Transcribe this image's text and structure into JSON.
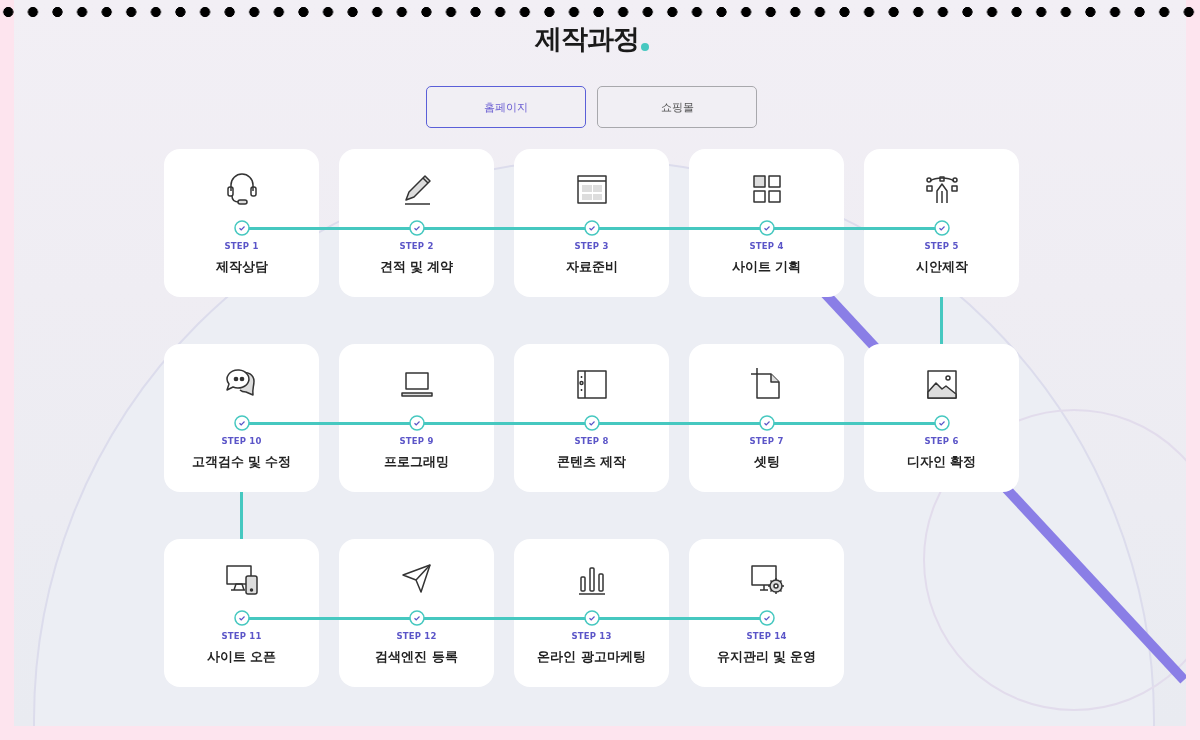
{
  "title": "제작과정",
  "tabs": [
    {
      "label": "홈페이지",
      "selected": true
    },
    {
      "label": "쇼핑몰",
      "selected": false
    }
  ],
  "rows": [
    {
      "steps": [
        {
          "step": "STEP 1",
          "label": "제작상담"
        },
        {
          "step": "STEP 2",
          "label": "견적 및 계약"
        },
        {
          "step": "STEP 3",
          "label": "자료준비"
        },
        {
          "step": "STEP 4",
          "label": "사이트 기획"
        },
        {
          "step": "STEP 5",
          "label": "시안제작"
        }
      ]
    },
    {
      "steps": [
        {
          "step": "STEP 10",
          "label": "고객검수 및 수정"
        },
        {
          "step": "STEP 9",
          "label": "프로그래밍"
        },
        {
          "step": "STEP 8",
          "label": "콘텐츠 제작"
        },
        {
          "step": "STEP 7",
          "label": "셋팅"
        },
        {
          "step": "STEP 6",
          "label": "디자인 확정"
        }
      ]
    },
    {
      "steps": [
        {
          "step": "STEP 11",
          "label": "사이트 오픈"
        },
        {
          "step": "STEP 12",
          "label": "검색엔진 등록"
        },
        {
          "step": "STEP 13",
          "label": "온라인 광고마케팅"
        },
        {
          "step": "STEP 14",
          "label": "유지관리 및 운영"
        }
      ]
    }
  ]
}
